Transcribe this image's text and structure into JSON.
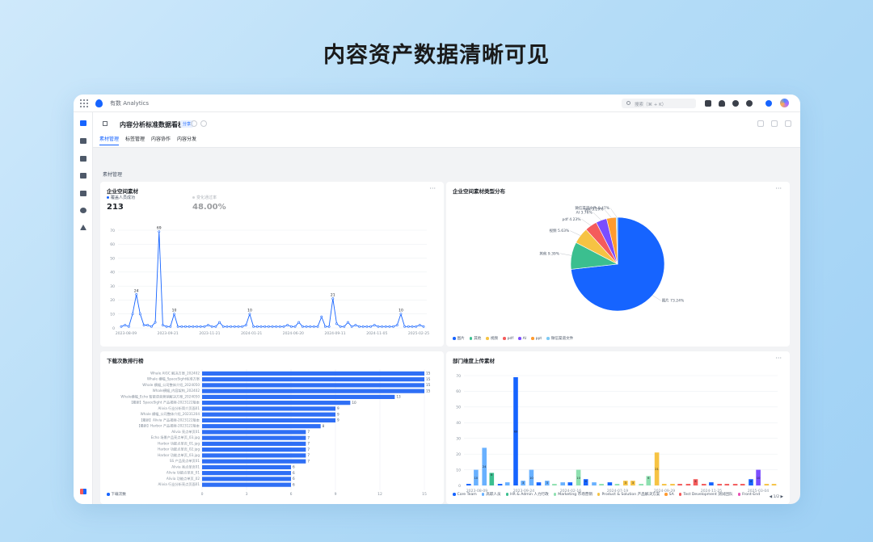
{
  "headline": "内容资产数据清晰可见",
  "app": {
    "name": "有数 Analytics",
    "search_placeholder": "搜索（⌘ + K）"
  },
  "dashboard": {
    "title": "内容分析标准数据看板",
    "badge": "分享"
  },
  "tabs": [
    {
      "label": "素材管理",
      "active": true
    },
    {
      "label": "标签管理",
      "active": false
    },
    {
      "label": "内容协作",
      "active": false
    },
    {
      "label": "内容分发",
      "active": false
    }
  ],
  "section_label": "素材管理",
  "colors": {
    "accent": "#1664ff",
    "bar": "#2f6ff5"
  },
  "icons": {
    "sidebar": [
      "dashboard-icon",
      "chart-icon",
      "list-icon",
      "trend-icon",
      "document-icon",
      "pie-icon",
      "warning-icon"
    ]
  },
  "cards": {
    "line": {
      "title": "企业空间素材",
      "metrics": [
        {
          "label": "覆盖人员成功",
          "value": "213",
          "color": "#1664ff"
        },
        {
          "label": "变化通过率",
          "value": "48.00%",
          "color": "#9aa0a6"
        }
      ]
    },
    "pie": {
      "title": "企业空间素材类型分布"
    },
    "hbar": {
      "title": "下载次数排行榜",
      "legend": "下载次数"
    },
    "vbar": {
      "title": "部门维度上传素材",
      "pager": "1/2"
    }
  },
  "chart_data": [
    {
      "type": "line",
      "title": "企业空间素材",
      "yticks": [
        "0",
        "10",
        "20",
        "30",
        "40",
        "50",
        "60",
        "70"
      ],
      "ylim": [
        0,
        70
      ],
      "xticks": [
        "2023-08-09",
        "2023-09-21",
        "2023-11-21",
        "2024-01-21",
        "2024-06-20",
        "2024-09-11",
        "2024-11-05",
        "2025-02-25"
      ],
      "values": [
        1,
        2,
        1,
        10,
        24,
        10,
        2,
        2,
        1,
        4,
        69,
        2,
        1,
        1,
        10,
        1,
        1,
        1,
        1,
        1,
        1,
        1,
        1,
        2,
        1,
        1,
        4,
        1,
        1,
        1,
        1,
        1,
        1,
        2,
        10,
        1,
        1,
        1,
        1,
        1,
        1,
        1,
        1,
        1,
        2,
        1,
        1,
        4,
        1,
        1,
        1,
        1,
        1,
        8,
        1,
        1,
        21,
        3,
        1,
        1,
        4,
        1,
        2,
        1,
        1,
        1,
        1,
        2,
        1,
        1,
        1,
        1,
        1,
        2,
        10,
        1,
        1,
        1,
        1,
        2,
        1
      ],
      "labeled": [
        {
          "index": 4,
          "text": "24"
        },
        {
          "index": 10,
          "text": "69"
        },
        {
          "index": 14,
          "text": "10"
        },
        {
          "index": 34,
          "text": "10"
        },
        {
          "index": 56,
          "text": "21"
        },
        {
          "index": 74,
          "text": "10"
        }
      ]
    },
    {
      "type": "pie",
      "title": "企业空间素材类型分布",
      "slices": [
        {
          "label": "图片",
          "percent": "73.24%",
          "value": 73.24,
          "color": "#1664ff"
        },
        {
          "label": "其他",
          "percent": "9.39%",
          "value": 9.39,
          "color": "#3bbf8f"
        },
        {
          "label": "视频",
          "percent": "5.63%",
          "value": 5.63,
          "color": "#f6c343"
        },
        {
          "label": "pdf",
          "percent": "4.23%",
          "value": 4.23,
          "color": "#f45b5b"
        },
        {
          "label": "AI",
          "percent": "3.76%",
          "value": 3.76,
          "color": "#7b4dff"
        },
        {
          "label": "ppt",
          "percent": "3.29%",
          "value": 3.29,
          "color": "#ff9a2e"
        },
        {
          "label": "微信渠道文件",
          "percent": "0.47%",
          "value": 0.47,
          "color": "#7ccaf5"
        }
      ]
    },
    {
      "type": "bar",
      "title": "下载次数排行榜",
      "orientation": "horizontal",
      "series_name": "下载次数",
      "xticks": [
        "0",
        "3",
        "6",
        "9",
        "12",
        "15"
      ],
      "xlim": [
        0,
        15
      ],
      "items": [
        {
          "label": "Whale AIGC 解决方案_202402",
          "value": 15
        },
        {
          "label": "Whale 横幅_SpaceSight标准方案",
          "value": 15
        },
        {
          "label": "Whale 横幅_公司整体介绍_2024050",
          "value": 15
        },
        {
          "label": "Whale横幅_内容架构_202402",
          "value": 15
        },
        {
          "label": "Whale横幅_Echo 智能语音营销解决方案_2024050",
          "value": 13
        },
        {
          "label": "【最新】SpaceSight 产品视频-2023122版本",
          "value": 10
        },
        {
          "label": "Alivia 行业分析简介页面01",
          "value": 9
        },
        {
          "label": "Whale 横幅_公司整体介绍_20231204",
          "value": 9
        },
        {
          "label": "【最新】Alivia 产品视频-2023122版本",
          "value": 9
        },
        {
          "label": "【最新】Harbor 产品视频-2023122版本",
          "value": 8
        },
        {
          "label": "Alivia 亮点单页01",
          "value": 7
        },
        {
          "label": "Echo 场景产品亮点单页_03.jpg",
          "value": 7
        },
        {
          "label": "Harbor 功能点单页_01.jpg",
          "value": 7
        },
        {
          "label": "Harbor 功能点单页_02.jpg",
          "value": 7
        },
        {
          "label": "Harbor 功能点单页_03.jpg",
          "value": 7
        },
        {
          "label": "SS 产品亮点单页01",
          "value": 7
        },
        {
          "label": "Alivia 亮点单页01",
          "value": 6
        },
        {
          "label": "Alivia 功能点单页_01",
          "value": 6
        },
        {
          "label": "Alivia 功能点单页_02",
          "value": 6
        },
        {
          "label": "Alivia 行业分析亮点页面01",
          "value": 6
        }
      ]
    },
    {
      "type": "bar",
      "title": "部门维度上传素材",
      "orientation": "vertical",
      "yticks": [
        "0",
        "10",
        "20",
        "30",
        "40",
        "50",
        "60",
        "70"
      ],
      "ylim": [
        0,
        70
      ],
      "xticks": [
        "2023-08-09",
        "2023-09-24",
        "2024-02-16",
        "2024-07-19",
        "2024-09-29",
        "2024-11-25",
        "2025-03-04"
      ],
      "groups": [
        [
          {
            "v": 1,
            "c": "#1664ff"
          },
          {
            "v": 10,
            "c": "#69b1ff"
          }
        ],
        [
          {
            "v": 24,
            "c": "#69b1ff"
          },
          {
            "v": 8,
            "c": "#3bbf8f"
          }
        ],
        [
          {
            "v": 1,
            "c": "#1664ff"
          },
          {
            "v": 2,
            "c": "#69b1ff"
          }
        ],
        [
          {
            "v": 69,
            "c": "#1664ff"
          },
          {
            "v": 3,
            "c": "#69b1ff"
          }
        ],
        [
          {
            "v": 10,
            "c": "#69b1ff"
          },
          {
            "v": 2,
            "c": "#1664ff"
          }
        ],
        [
          {
            "v": 3,
            "c": "#69b1ff"
          },
          {
            "v": 1,
            "c": "#8ee0b0"
          }
        ],
        [
          {
            "v": 2,
            "c": "#69b1ff"
          },
          {
            "v": 2,
            "c": "#1664ff"
          }
        ],
        [
          {
            "v": 10,
            "c": "#8ee0b0"
          },
          {
            "v": 4,
            "c": "#1664ff"
          }
        ],
        [
          {
            "v": 2,
            "c": "#69b1ff"
          },
          {
            "v": 1,
            "c": "#8ee0b0"
          }
        ],
        [
          {
            "v": 2,
            "c": "#1664ff"
          },
          {
            "v": 1,
            "c": "#8ee0b0"
          }
        ],
        [
          {
            "v": 3,
            "c": "#f6c343"
          },
          {
            "v": 3,
            "c": "#f6c343"
          }
        ],
        [
          {
            "v": 1,
            "c": "#8ee0b0"
          },
          {
            "v": 6,
            "c": "#8ee0b0"
          }
        ],
        [
          {
            "v": 21,
            "c": "#f6c343"
          },
          {
            "v": 1,
            "c": "#f6c343"
          }
        ],
        [
          {
            "v": 1,
            "c": "#f6c343"
          },
          {
            "v": 1,
            "c": "#f45b5b"
          }
        ],
        [
          {
            "v": 1,
            "c": "#f45b5b"
          },
          {
            "v": 4,
            "c": "#f45b5b"
          }
        ],
        [
          {
            "v": 1,
            "c": "#f45b5b"
          },
          {
            "v": 2,
            "c": "#1664ff"
          }
        ],
        [
          {
            "v": 1,
            "c": "#f45b5b"
          },
          {
            "v": 1,
            "c": "#f45b5b"
          }
        ],
        [
          {
            "v": 1,
            "c": "#f45b5b"
          },
          {
            "v": 1,
            "c": "#f45b5b"
          }
        ],
        [
          {
            "v": 4,
            "c": "#1664ff"
          },
          {
            "v": 10,
            "c": "#7b4dff"
          }
        ],
        [
          {
            "v": 1,
            "c": "#f6c343"
          },
          {
            "v": 1,
            "c": "#f6c343"
          }
        ]
      ],
      "legend": [
        {
          "label": "Core Team",
          "color": "#1664ff"
        },
        {
          "label": "高职人员",
          "color": "#69b1ff"
        },
        {
          "label": "HR & Admin 人力行政",
          "color": "#3bbf8f"
        },
        {
          "label": "Marketing 市场营销",
          "color": "#8ee0b0"
        },
        {
          "label": "Product & Solution 产品解决方案",
          "color": "#f6c343"
        },
        {
          "label": "SA",
          "color": "#ff9a2e"
        },
        {
          "label": "Test Development 测试团队",
          "color": "#f45b5b"
        },
        {
          "label": "Front-End",
          "color": "#e94fb5"
        }
      ]
    }
  ]
}
